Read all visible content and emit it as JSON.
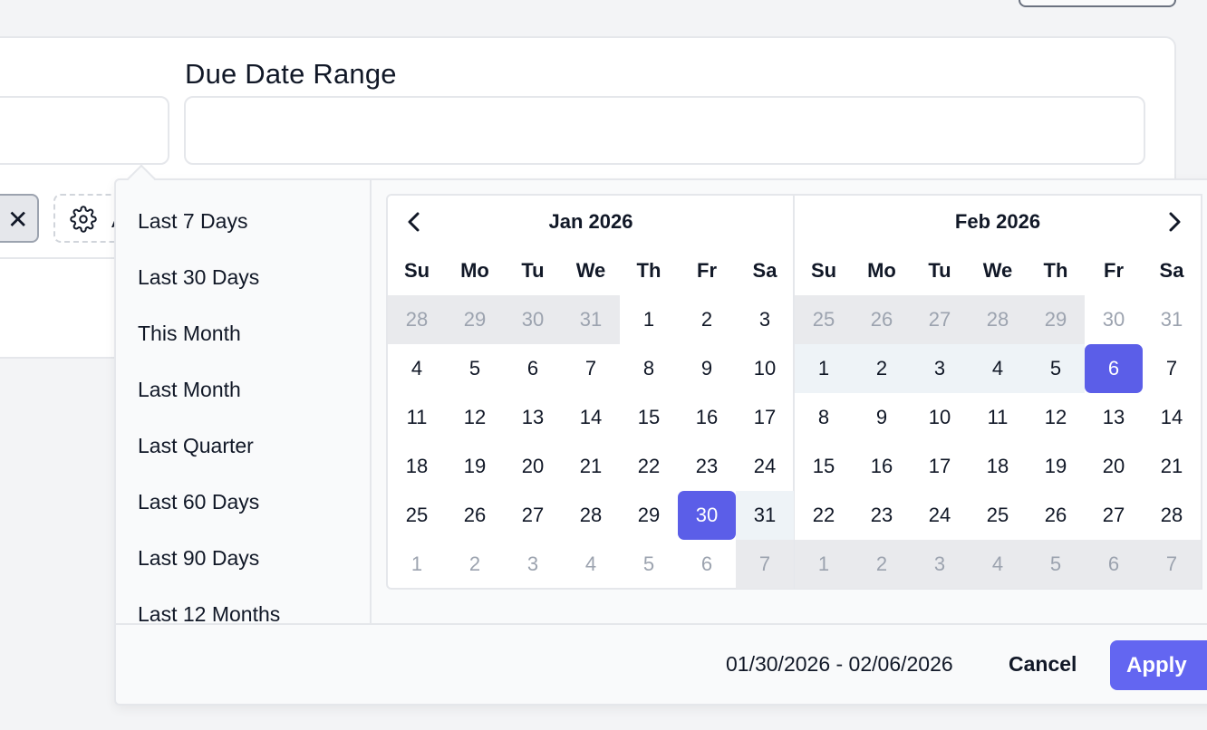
{
  "filters": {
    "due_date_label": "Due Date Range",
    "due_date_value": "",
    "clear_chip_label": "✕",
    "settings_chip_label": "A"
  },
  "presets": [
    {
      "label": "Last 7 Days"
    },
    {
      "label": "Last 30 Days"
    },
    {
      "label": "This Month"
    },
    {
      "label": "Last Month"
    },
    {
      "label": "Last Quarter"
    },
    {
      "label": "Last 60 Days"
    },
    {
      "label": "Last 90 Days"
    },
    {
      "label": "Last 12 Months"
    }
  ],
  "weekdays": [
    "Su",
    "Mo",
    "Tu",
    "We",
    "Th",
    "Fr",
    "Sa"
  ],
  "calendars": [
    {
      "title": "Jan 2026",
      "weeks": [
        [
          {
            "d": "28",
            "s": "disabled"
          },
          {
            "d": "29",
            "s": "disabled"
          },
          {
            "d": "30",
            "s": "disabled"
          },
          {
            "d": "31",
            "s": "disabled"
          },
          {
            "d": "1",
            "s": ""
          },
          {
            "d": "2",
            "s": ""
          },
          {
            "d": "3",
            "s": ""
          }
        ],
        [
          {
            "d": "4",
            "s": ""
          },
          {
            "d": "5",
            "s": ""
          },
          {
            "d": "6",
            "s": ""
          },
          {
            "d": "7",
            "s": ""
          },
          {
            "d": "8",
            "s": ""
          },
          {
            "d": "9",
            "s": ""
          },
          {
            "d": "10",
            "s": ""
          }
        ],
        [
          {
            "d": "11",
            "s": ""
          },
          {
            "d": "12",
            "s": ""
          },
          {
            "d": "13",
            "s": ""
          },
          {
            "d": "14",
            "s": ""
          },
          {
            "d": "15",
            "s": ""
          },
          {
            "d": "16",
            "s": ""
          },
          {
            "d": "17",
            "s": ""
          }
        ],
        [
          {
            "d": "18",
            "s": ""
          },
          {
            "d": "19",
            "s": ""
          },
          {
            "d": "20",
            "s": ""
          },
          {
            "d": "21",
            "s": ""
          },
          {
            "d": "22",
            "s": ""
          },
          {
            "d": "23",
            "s": ""
          },
          {
            "d": "24",
            "s": ""
          }
        ],
        [
          {
            "d": "25",
            "s": ""
          },
          {
            "d": "26",
            "s": ""
          },
          {
            "d": "27",
            "s": ""
          },
          {
            "d": "28",
            "s": ""
          },
          {
            "d": "29",
            "s": ""
          },
          {
            "d": "30",
            "s": "selected"
          },
          {
            "d": "31",
            "s": "inrange"
          }
        ],
        [
          {
            "d": "1",
            "s": "other"
          },
          {
            "d": "2",
            "s": "other"
          },
          {
            "d": "3",
            "s": "other"
          },
          {
            "d": "4",
            "s": "other"
          },
          {
            "d": "5",
            "s": "other"
          },
          {
            "d": "6",
            "s": "other"
          },
          {
            "d": "7",
            "s": "disabled"
          }
        ]
      ]
    },
    {
      "title": "Feb 2026",
      "weeks": [
        [
          {
            "d": "25",
            "s": "disabled"
          },
          {
            "d": "26",
            "s": "disabled"
          },
          {
            "d": "27",
            "s": "disabled"
          },
          {
            "d": "28",
            "s": "disabled"
          },
          {
            "d": "29",
            "s": "disabled"
          },
          {
            "d": "30",
            "s": "other"
          },
          {
            "d": "31",
            "s": "other"
          }
        ],
        [
          {
            "d": "1",
            "s": "inrange"
          },
          {
            "d": "2",
            "s": "inrange"
          },
          {
            "d": "3",
            "s": "inrange"
          },
          {
            "d": "4",
            "s": "inrange"
          },
          {
            "d": "5",
            "s": "inrange"
          },
          {
            "d": "6",
            "s": "selected"
          },
          {
            "d": "7",
            "s": ""
          }
        ],
        [
          {
            "d": "8",
            "s": ""
          },
          {
            "d": "9",
            "s": ""
          },
          {
            "d": "10",
            "s": ""
          },
          {
            "d": "11",
            "s": ""
          },
          {
            "d": "12",
            "s": ""
          },
          {
            "d": "13",
            "s": ""
          },
          {
            "d": "14",
            "s": ""
          }
        ],
        [
          {
            "d": "15",
            "s": ""
          },
          {
            "d": "16",
            "s": ""
          },
          {
            "d": "17",
            "s": ""
          },
          {
            "d": "18",
            "s": ""
          },
          {
            "d": "19",
            "s": ""
          },
          {
            "d": "20",
            "s": ""
          },
          {
            "d": "21",
            "s": ""
          }
        ],
        [
          {
            "d": "22",
            "s": ""
          },
          {
            "d": "23",
            "s": ""
          },
          {
            "d": "24",
            "s": ""
          },
          {
            "d": "25",
            "s": ""
          },
          {
            "d": "26",
            "s": ""
          },
          {
            "d": "27",
            "s": ""
          },
          {
            "d": "28",
            "s": ""
          }
        ],
        [
          {
            "d": "1",
            "s": "disabled"
          },
          {
            "d": "2",
            "s": "disabled"
          },
          {
            "d": "3",
            "s": "disabled"
          },
          {
            "d": "4",
            "s": "disabled"
          },
          {
            "d": "5",
            "s": "disabled"
          },
          {
            "d": "6",
            "s": "disabled"
          },
          {
            "d": "7",
            "s": "disabled"
          }
        ]
      ]
    }
  ],
  "footer": {
    "selected_range": "01/30/2026 - 02/06/2026",
    "cancel_label": "Cancel",
    "apply_label": "Apply"
  },
  "colors": {
    "accent": "#5b5ee8",
    "in_range": "#eef3f7",
    "disabled": "#e9eaed"
  },
  "icons": {
    "prev": "chevron-left-icon",
    "next": "chevron-right-icon",
    "settings": "gear-icon",
    "clear": "close-icon"
  }
}
